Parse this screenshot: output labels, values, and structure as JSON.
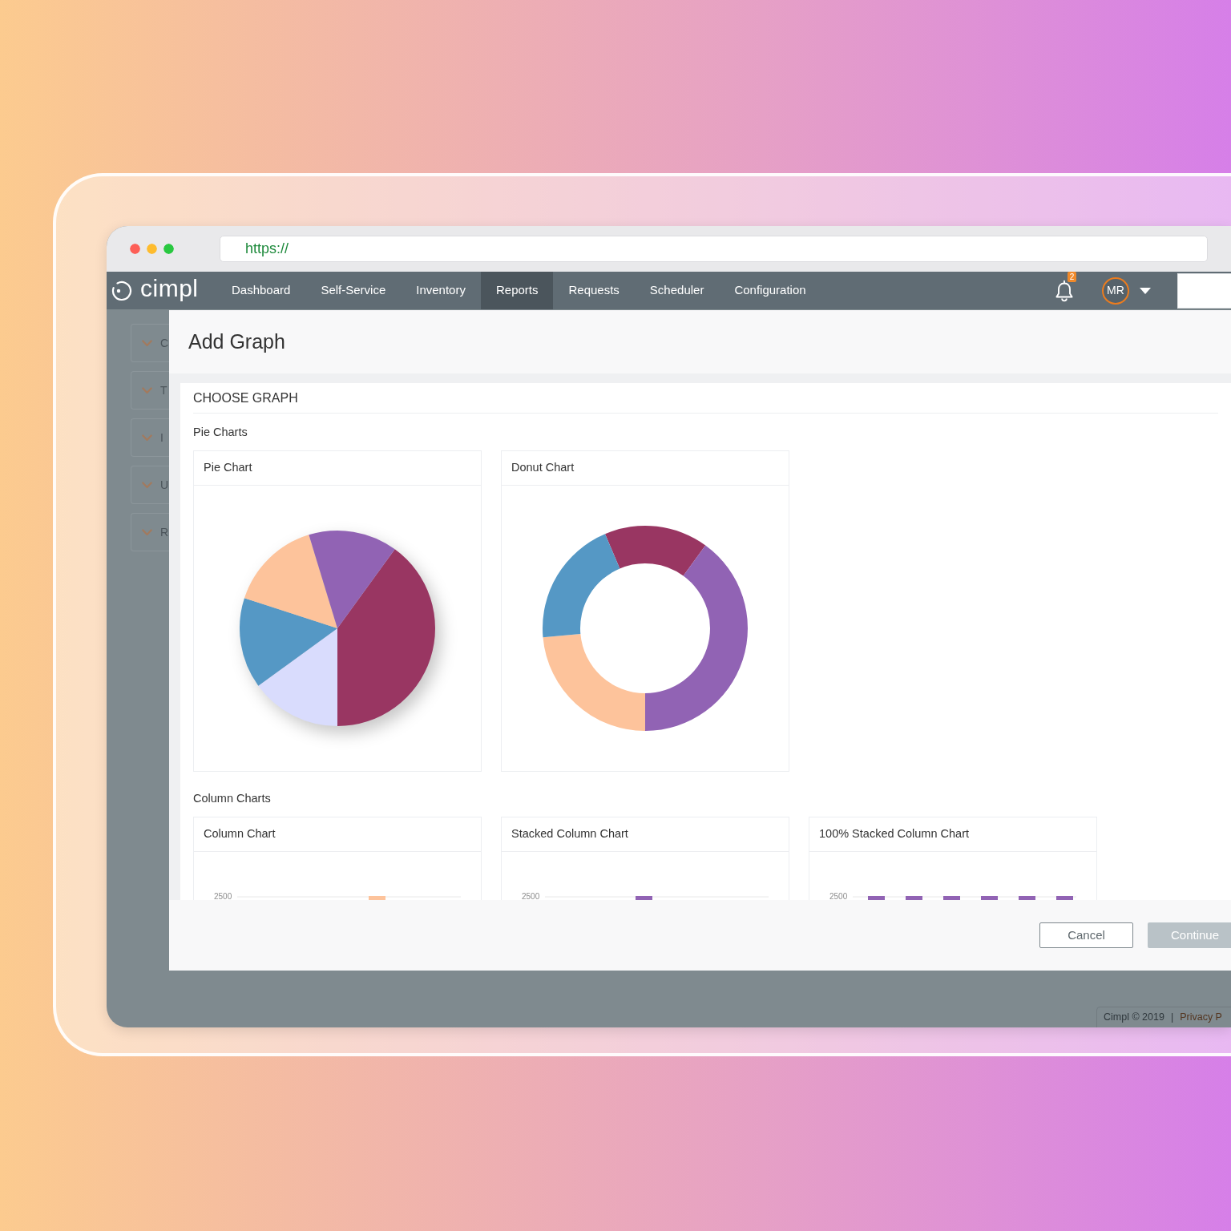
{
  "browser": {
    "url": "https://"
  },
  "navbar": {
    "logo": "cimpl",
    "items": [
      {
        "label": "Dashboard",
        "selected": false
      },
      {
        "label": "Self-Service",
        "selected": false
      },
      {
        "label": "Inventory",
        "selected": false
      },
      {
        "label": "Reports",
        "selected": true
      },
      {
        "label": "Requests",
        "selected": false
      },
      {
        "label": "Scheduler",
        "selected": false
      },
      {
        "label": "Configuration",
        "selected": false
      }
    ],
    "notification_count": "2",
    "user_initials": "MR"
  },
  "sidebar": {
    "items": [
      {
        "label": "C"
      },
      {
        "label": "T"
      },
      {
        "label": "I"
      },
      {
        "label": "U"
      },
      {
        "label": "R"
      }
    ]
  },
  "modal": {
    "title": "Add Graph",
    "section_title": "CHOOSE GRAPH",
    "groups": [
      {
        "title": "Pie Charts",
        "cards": [
          {
            "title": "Pie Chart",
            "kind": "pie"
          },
          {
            "title": "Donut Chart",
            "kind": "donut"
          }
        ]
      },
      {
        "title": "Column Charts",
        "cards": [
          {
            "title": "Column Chart",
            "kind": "column",
            "axis_label": "2500"
          },
          {
            "title": "Stacked Column Chart",
            "kind": "stacked_column",
            "axis_label": "2500"
          },
          {
            "title": "100% Stacked Column Chart",
            "kind": "percent_stacked_column",
            "axis_label": "2500"
          }
        ]
      }
    ],
    "buttons": [
      {
        "label": "Cancel",
        "kind": "outline",
        "disabled": false
      },
      {
        "label": "Continue",
        "kind": "primary",
        "disabled": true
      }
    ]
  },
  "footer": {
    "copyright": "Cimpl © 2019",
    "separator": "|",
    "link": "Privacy P"
  }
}
